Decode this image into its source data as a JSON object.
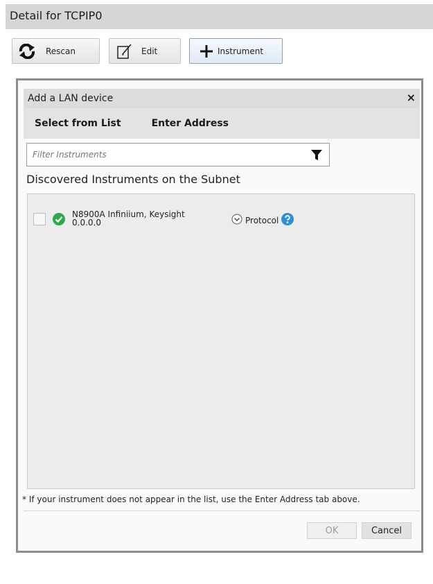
{
  "header": {
    "title": "Detail for TCPIP0"
  },
  "toolbar": {
    "rescan_label": "Rescan",
    "edit_label": "Edit",
    "instrument_label": "Instrument"
  },
  "dialog": {
    "title": "Add a LAN device",
    "close_glyph": "×",
    "tabs": [
      {
        "label": "Select from List"
      },
      {
        "label": "Enter Address"
      }
    ],
    "filter_placeholder": "Filter Instruments",
    "section_title": "Discovered Instruments on the Subnet",
    "instruments": [
      {
        "name": "N8900A Infiniium, Keysight",
        "address": "0.0.0.0",
        "protocol_label": "Protocol",
        "checked": false,
        "status_icon": "check-circle-icon"
      }
    ],
    "note": "* If your instrument does not appear in the list, use the Enter Address tab above.",
    "ok_label": "OK",
    "cancel_label": "Cancel"
  },
  "colors": {
    "header_bg": "#d6d6d6",
    "status_green": "#2ea84a",
    "help_blue": "#2f8fd6",
    "instrument_button_border": "#6ea6d6"
  }
}
